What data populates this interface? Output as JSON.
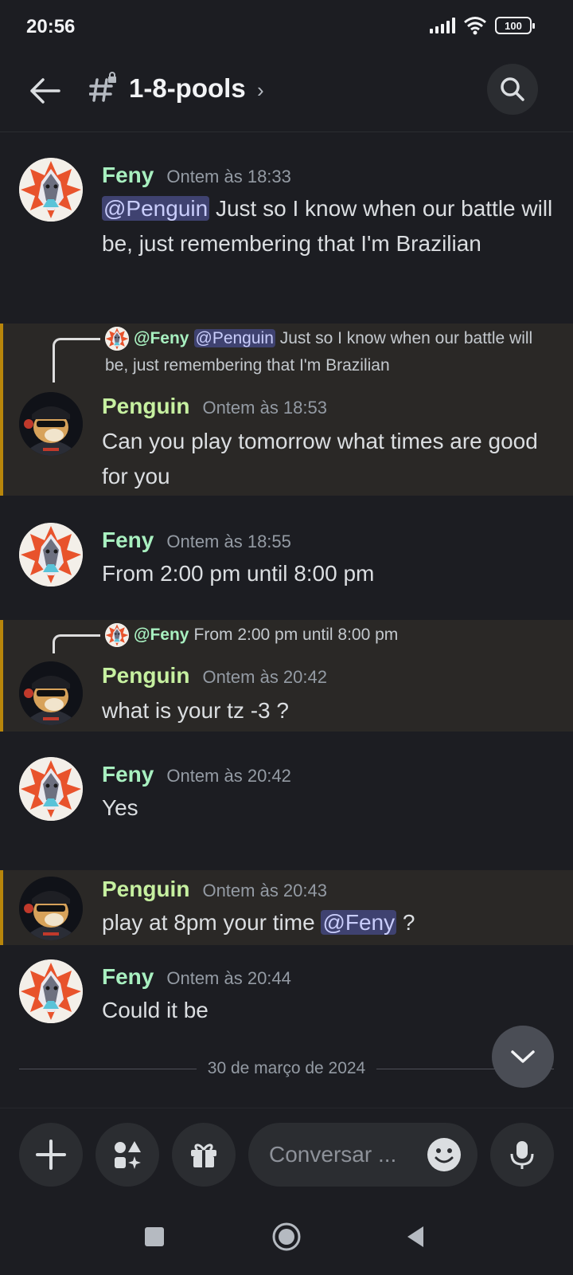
{
  "status_bar": {
    "time": "20:56",
    "battery": "100"
  },
  "header": {
    "channel_name": "1-8-pools",
    "chevron": "›"
  },
  "messages": [
    {
      "author": "Feny",
      "timestamp": "Ontem às 18:33",
      "mention": "@Penguin",
      "text": " Just so I know when our battle will be, just remembering that I'm Brazilian"
    },
    {
      "reply_author": "@Feny",
      "reply_mention": "@Penguin",
      "reply_text": " Just so I know when our battle will be, just remembering that I'm Brazilian",
      "author": "Penguin",
      "timestamp": "Ontem às 18:53",
      "text": "Can you play tomorrow what times are good for you"
    },
    {
      "author": "Feny",
      "timestamp": "Ontem às 18:55",
      "text": "From 2:00 pm until 8:00 pm"
    },
    {
      "reply_author": "@Feny",
      "reply_text": "From 2:00 pm until 8:00 pm",
      "author": "Penguin",
      "timestamp": "Ontem às 20:42",
      "text": "what is your tz -3 ?"
    },
    {
      "author": "Feny",
      "timestamp": "Ontem às 20:42",
      "text": "Yes"
    },
    {
      "author": "Penguin",
      "timestamp": "Ontem às 20:43",
      "text_before": "play at 8pm your time ",
      "mention": "@Feny",
      "text_after": " ?"
    },
    {
      "author": "Feny",
      "timestamp": "Ontem às 20:44",
      "text": "Could it be"
    }
  ],
  "divider": {
    "date": "30 de março de 2024"
  },
  "composer": {
    "placeholder": "Conversar ..."
  },
  "colors": {
    "background": "#1c1d22",
    "highlight_border": "#b8860b",
    "mention_bg": "#3f4270"
  }
}
